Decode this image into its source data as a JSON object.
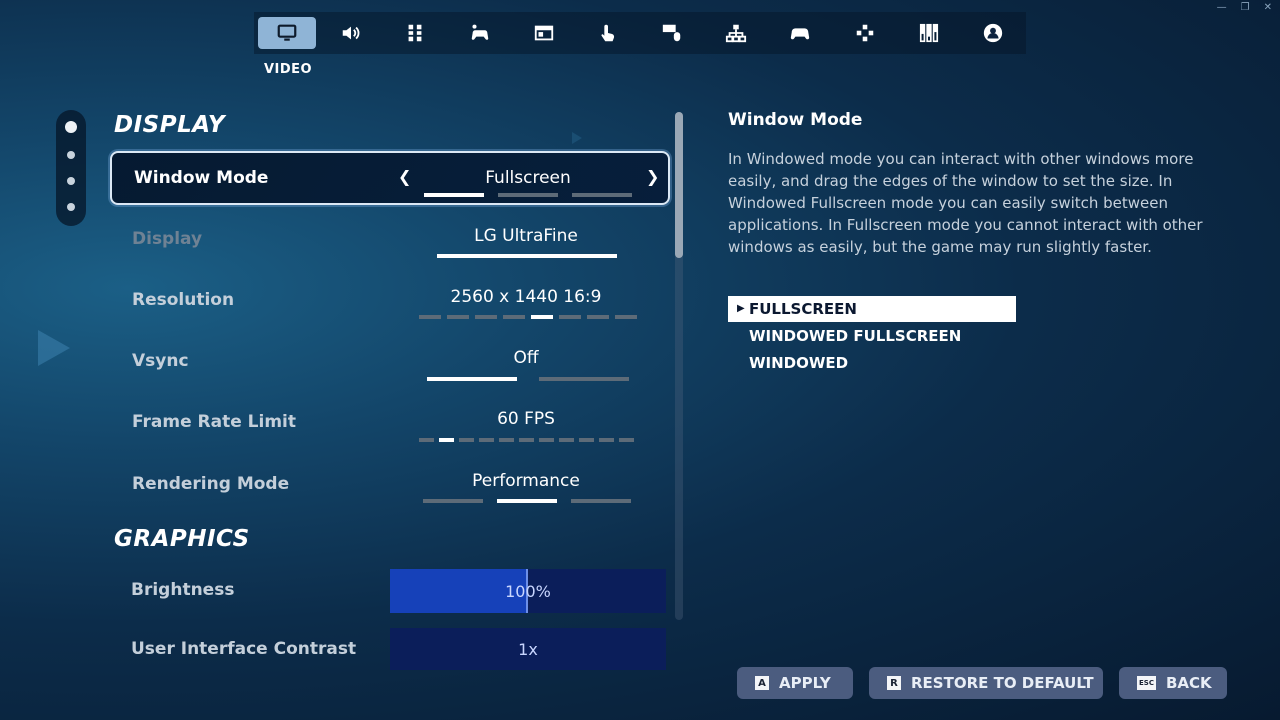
{
  "nav": {
    "tabs": [
      {
        "icon": "monitor-icon",
        "label": "VIDEO",
        "active": true
      },
      {
        "icon": "speaker-icon"
      },
      {
        "icon": "game-ui-icon"
      },
      {
        "icon": "accessibility-controller-icon"
      },
      {
        "icon": "window-icon"
      },
      {
        "icon": "touch-icon"
      },
      {
        "icon": "keyboard-mouse-icon"
      },
      {
        "icon": "network-icon"
      },
      {
        "icon": "controller-icon"
      },
      {
        "icon": "dpad-icon"
      },
      {
        "icon": "equalizer-icon"
      },
      {
        "icon": "account-icon"
      }
    ],
    "active_label": "VIDEO"
  },
  "sections": {
    "display": "DISPLAY",
    "graphics": "GRAPHICS"
  },
  "settings": {
    "window_mode": {
      "label": "Window Mode",
      "value": "Fullscreen",
      "options_count": 3,
      "selected_index": 0
    },
    "display": {
      "label": "Display",
      "value": "LG UltraFine"
    },
    "resolution": {
      "label": "Resolution",
      "value": "2560 x 1440 16:9",
      "options_count": 8,
      "selected_index": 4
    },
    "vsync": {
      "label": "Vsync",
      "value": "Off",
      "options_count": 2,
      "selected_index": 0
    },
    "frame_rate_limit": {
      "label": "Frame Rate Limit",
      "value": "60 FPS",
      "options_count": 11,
      "selected_index": 1
    },
    "rendering_mode": {
      "label": "Rendering Mode",
      "value": "Performance",
      "options_count": 3,
      "selected_index": 1
    },
    "brightness": {
      "label": "Brightness",
      "value": "100%",
      "fill_fraction": 0.5
    },
    "ui_contrast": {
      "label": "User Interface Contrast",
      "value": "1x",
      "fill_fraction": 0
    }
  },
  "detail": {
    "title": "Window Mode",
    "body": "In Windowed mode you can interact with other windows more easily, and drag the edges of the window to set the size. In Windowed Fullscreen mode you can easily switch between applications. In Fullscreen mode you cannot interact with other windows as easily, but the game may run slightly faster.",
    "options": [
      "FULLSCREEN",
      "WINDOWED FULLSCREEN",
      "WINDOWED"
    ],
    "selected_index": 0
  },
  "buttons": {
    "apply": {
      "key": "A",
      "label": "APPLY"
    },
    "restore": {
      "key": "R",
      "label": "RESTORE TO DEFAULT"
    },
    "back": {
      "key": "ESC",
      "label": "BACK"
    }
  },
  "colors": {
    "slider_fill": "#1641b9",
    "slider_track": "#0b1e5a",
    "active_tab": "#8fb4d6"
  }
}
